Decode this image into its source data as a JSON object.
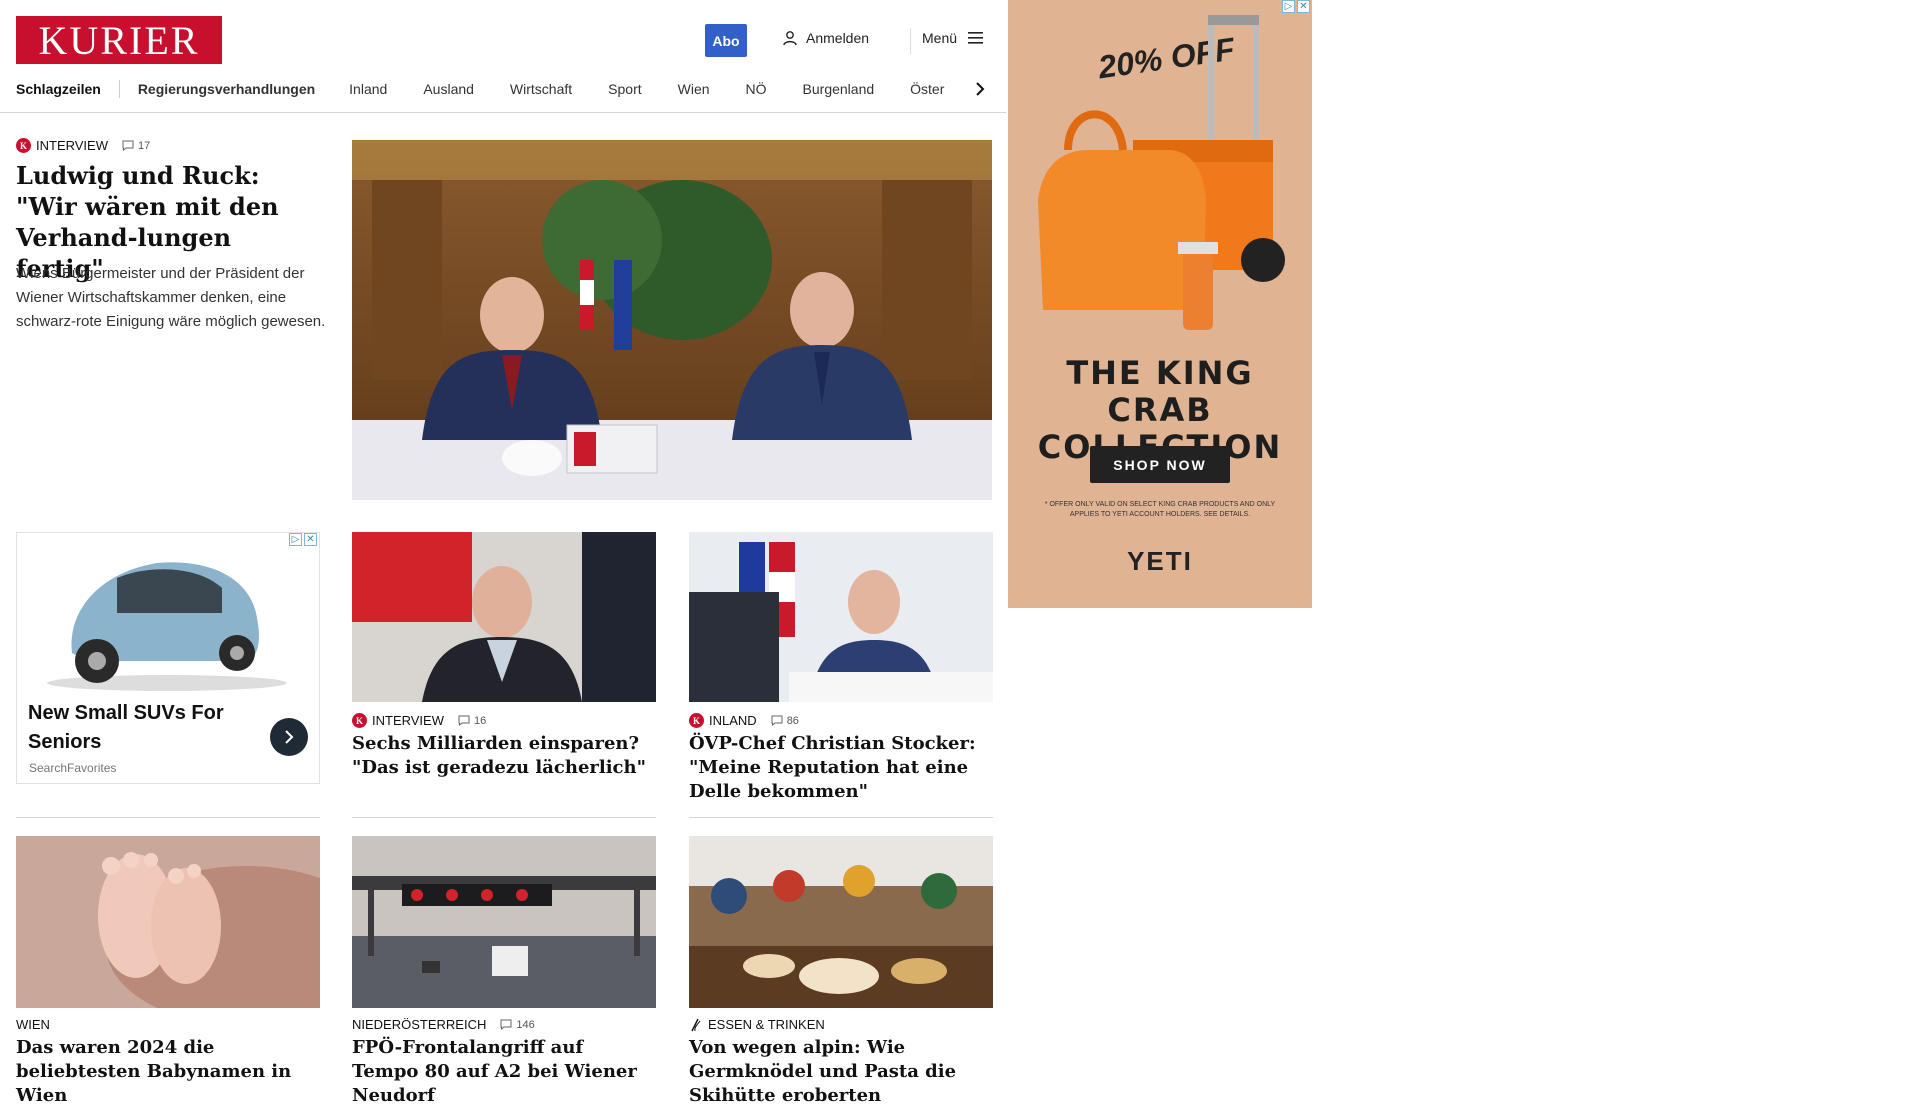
{
  "header": {
    "logo": "KURIER",
    "abo": "Abo",
    "login": "Anmelden",
    "menu": "Menü"
  },
  "nav": {
    "items": [
      "Schlagzeilen",
      "Regierungsverhandlungen",
      "Inland",
      "Ausland",
      "Wirtschaft",
      "Sport",
      "Wien",
      "NÖ",
      "Burgenland",
      "Öster"
    ]
  },
  "lead": {
    "category": "INTERVIEW",
    "comments": "17",
    "title": "Ludwig und Ruck: \"Wir wären mit den Verhand-lungen fertig\"",
    "teaser": "Wiens Bürgermeister und der Präsident der Wiener Wirtschaftskammer denken, eine schwarz-rote Einigung wäre möglich gewesen.",
    "image": "photo-two-men-at-table"
  },
  "native_ad": {
    "title": "New Small SUVs For Seniors",
    "source": "SearchFavorites"
  },
  "cards": [
    {
      "category": "INTERVIEW",
      "comments": "16",
      "title": "Sechs Milliarden einsparen? \"Das ist geradezu lächerlich\"",
      "icon": "kurier-plus-icon"
    },
    {
      "category": "INLAND",
      "comments": "86",
      "title": "ÖVP-Chef Christian Stocker: \"Meine Reputation hat eine Delle bekommen\"",
      "icon": "kurier-plus-icon"
    },
    {
      "category": "WIEN",
      "comments": "",
      "title": "Das waren 2024 die beliebtesten Babynamen in Wien",
      "icon": ""
    },
    {
      "category": "NIEDERÖSTERREICH",
      "comments": "146",
      "title": "FPÖ-Frontalangriff auf Tempo 80 auf A2 bei Wiener Neudorf",
      "icon": ""
    },
    {
      "category": "ESSEN & TRINKEN",
      "comments": "",
      "title": "Von wegen alpin: Wie Germknödel und Pasta die Skihütte eroberten",
      "icon": "food-icon"
    }
  ],
  "yeti_ad": {
    "offer": "20% OFF",
    "headline_1": "THE KING CRAB",
    "headline_2": "COLLECTION",
    "cta": "SHOP NOW",
    "fine_print": "* OFFER ONLY VALID ON SELECT KING CRAB PRODUCTS AND ONLY APPLIES TO YETI ACCOUNT HOLDERS. SEE DETAILS.",
    "brand": "YETI"
  },
  "colors": {
    "brand_red": "#c8102e",
    "abo_blue": "#3260c8",
    "ad_bg": "#e0b393"
  }
}
